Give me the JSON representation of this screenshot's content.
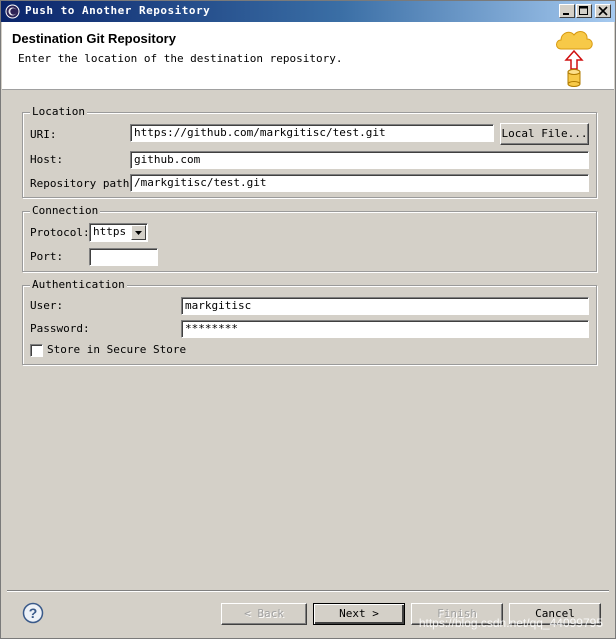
{
  "window": {
    "title": "Push to Another Repository"
  },
  "header": {
    "title": "Destination Git Repository",
    "description": "Enter the location of the destination repository.",
    "graphic_icon": "cloud-push-icon"
  },
  "location": {
    "legend": "Location",
    "uri_label": "URI:",
    "uri_value": "https://github.com/markgitisc/test.git",
    "local_file_button": "Local File...",
    "host_label": "Host:",
    "host_value": "github.com",
    "repo_path_label": "Repository path:",
    "repo_path_value": "/markgitisc/test.git"
  },
  "connection": {
    "legend": "Connection",
    "protocol_label": "Protocol:",
    "protocol_value": "https",
    "port_label": "Port:",
    "port_value": ""
  },
  "authentication": {
    "legend": "Authentication",
    "user_label": "User:",
    "user_value": "markgitisc",
    "password_label": "Password:",
    "password_value": "********",
    "store_label": "Store in Secure Store",
    "store_checked": false
  },
  "footer": {
    "back_button": "< Back",
    "next_button": "Next >",
    "finish_button": "Finish",
    "cancel_button": "Cancel",
    "help_icon": "help-icon"
  },
  "watermark": "https://blog.csdn.net/qq_44099795"
}
